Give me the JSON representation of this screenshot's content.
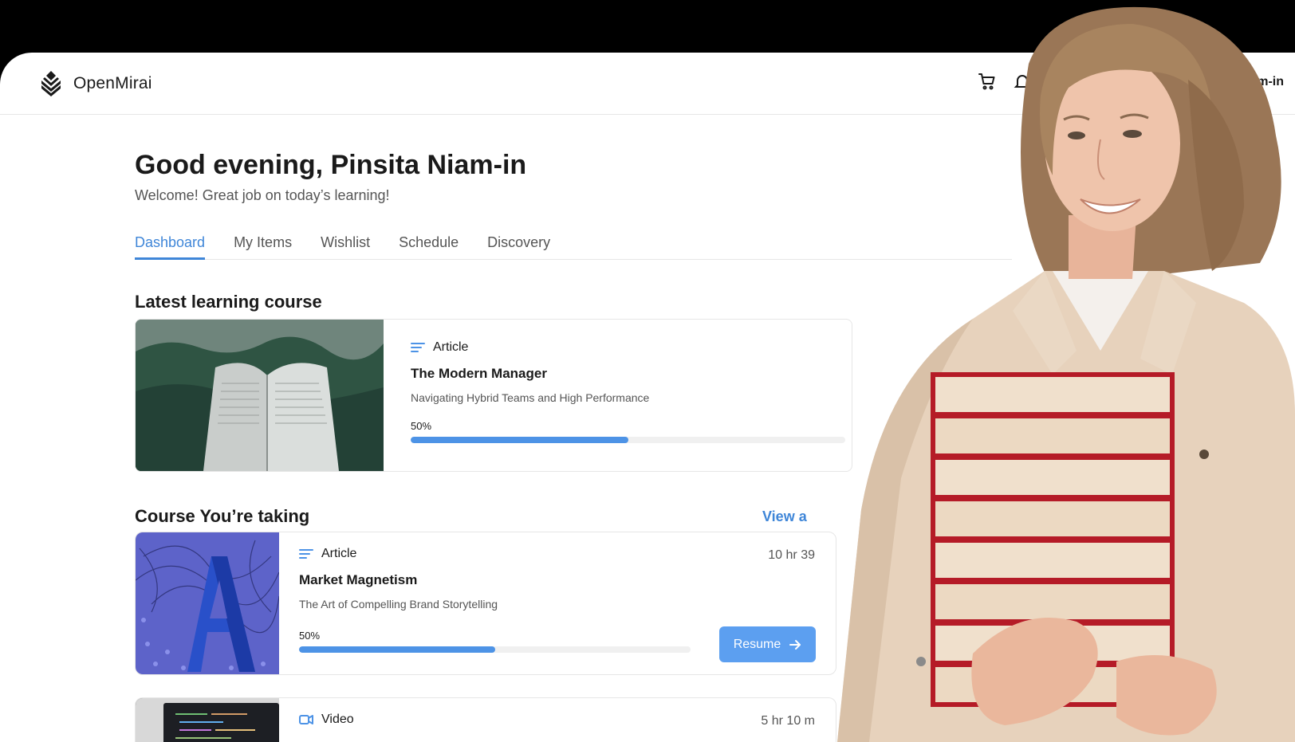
{
  "app": {
    "name": "OpenMirai",
    "user_name_partial": "Niam-in"
  },
  "greeting": {
    "title": "Good evening, Pinsita Niam-in",
    "subtitle": "Welcome! Great job on today’s learning!"
  },
  "tabs": [
    {
      "label": "Dashboard",
      "active": true
    },
    {
      "label": "My Items",
      "active": false
    },
    {
      "label": "Wishlist",
      "active": false
    },
    {
      "label": "Schedule",
      "active": false
    },
    {
      "label": "Discovery",
      "active": false
    }
  ],
  "latest": {
    "section_title": "Latest learning course",
    "type": "Article",
    "title": "The Modern Manager",
    "subtitle": "Navigating Hybrid Teams and High Performance",
    "progress_label": "50%",
    "progress": 0.5
  },
  "taking": {
    "section_title": "Course You’re taking",
    "view_all": "View a",
    "courses": [
      {
        "type": "Article",
        "title": "Market Magnetism",
        "subtitle": "The Art of Compelling Brand Storytelling",
        "progress_label": "50%",
        "progress": 0.5,
        "duration": "10 hr 39",
        "button": "Resume"
      },
      {
        "type": "Video",
        "duration": "5 hr 10 m"
      }
    ]
  },
  "colors": {
    "accent": "#3f86d8",
    "progress": "#4d93e6",
    "button": "#5c9ff0"
  }
}
